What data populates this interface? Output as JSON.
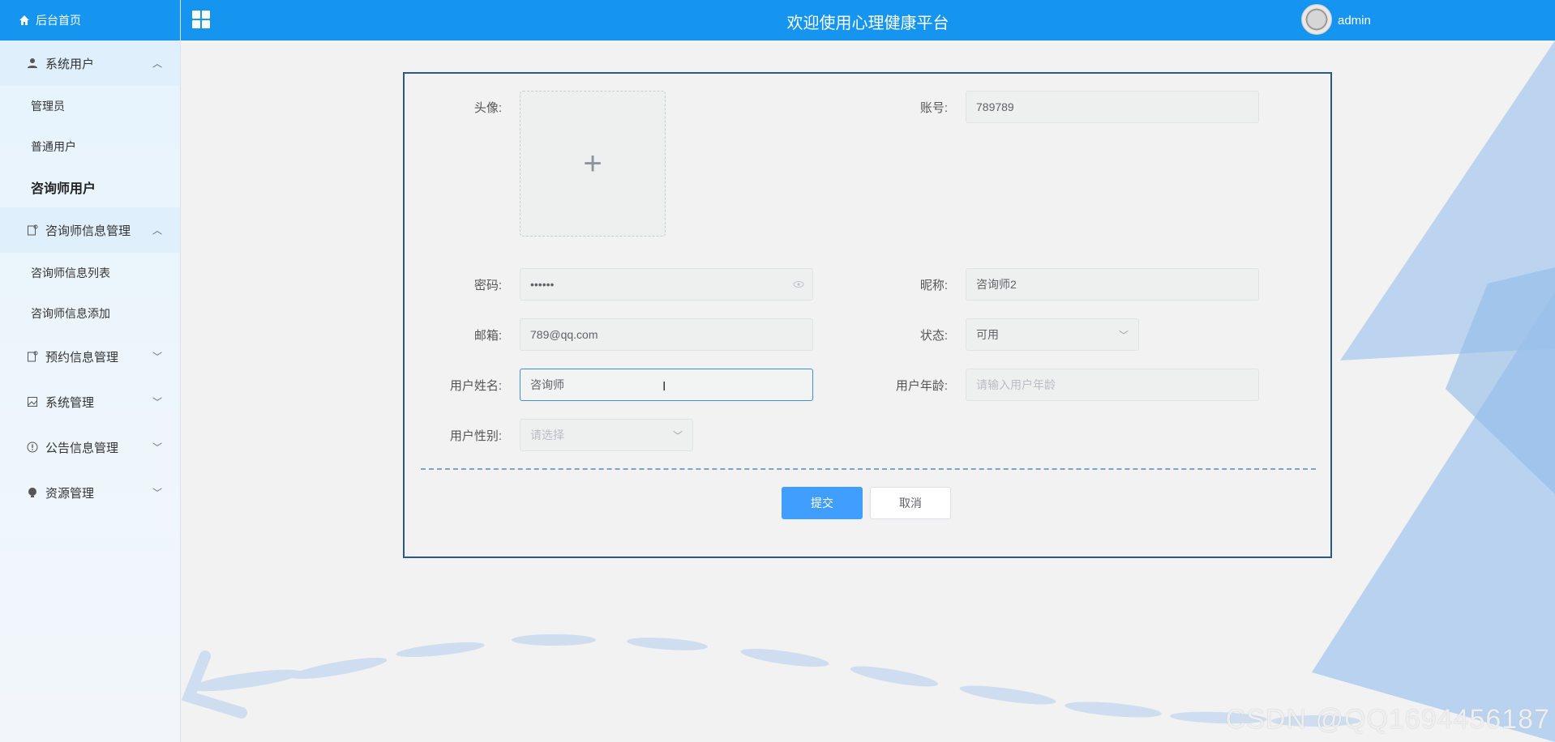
{
  "colors": {
    "accent": "#1595ef",
    "primary_button": "#409eff",
    "card_border": "#2a5a80"
  },
  "topbar": {
    "title": "欢迎使用心理健康平台",
    "user": "admin",
    "grid_icon": "grid-icon",
    "avatar_icon": "avatar"
  },
  "sidebar": {
    "home": "后台首页",
    "groups": [
      {
        "label": "系统用户",
        "icon": "user-icon",
        "expanded": true,
        "items": [
          "管理员",
          "普通用户",
          "咨询师用户"
        ]
      },
      {
        "label": "咨询师信息管理",
        "icon": "doc-icon",
        "expanded": true,
        "items": [
          "咨询师信息列表",
          "咨询师信息添加"
        ]
      },
      {
        "label": "预约信息管理",
        "icon": "doc-icon",
        "expanded": false
      },
      {
        "label": "系统管理",
        "icon": "image-icon",
        "expanded": false
      },
      {
        "label": "公告信息管理",
        "icon": "info-icon",
        "expanded": false
      },
      {
        "label": "资源管理",
        "icon": "bulb-icon",
        "expanded": false
      }
    ],
    "active_item": "咨询师用户"
  },
  "form": {
    "avatar_label": "头像:",
    "account_label": "账号:",
    "account_value": "789789",
    "password_label": "密码:",
    "password_value": "••••••",
    "nickname_label": "昵称:",
    "nickname_value": "咨询师2",
    "email_label": "邮箱:",
    "email_value": "789@qq.com",
    "status_label": "状态:",
    "status_value": "可用",
    "realname_label": "用户姓名:",
    "realname_value": "咨询师",
    "age_label": "用户年龄:",
    "age_placeholder": "请输入用户年龄",
    "gender_label": "用户性别:",
    "gender_placeholder": "请选择",
    "submit": "提交",
    "cancel": "取消"
  },
  "watermark": "CSDN @QQ1694456187"
}
